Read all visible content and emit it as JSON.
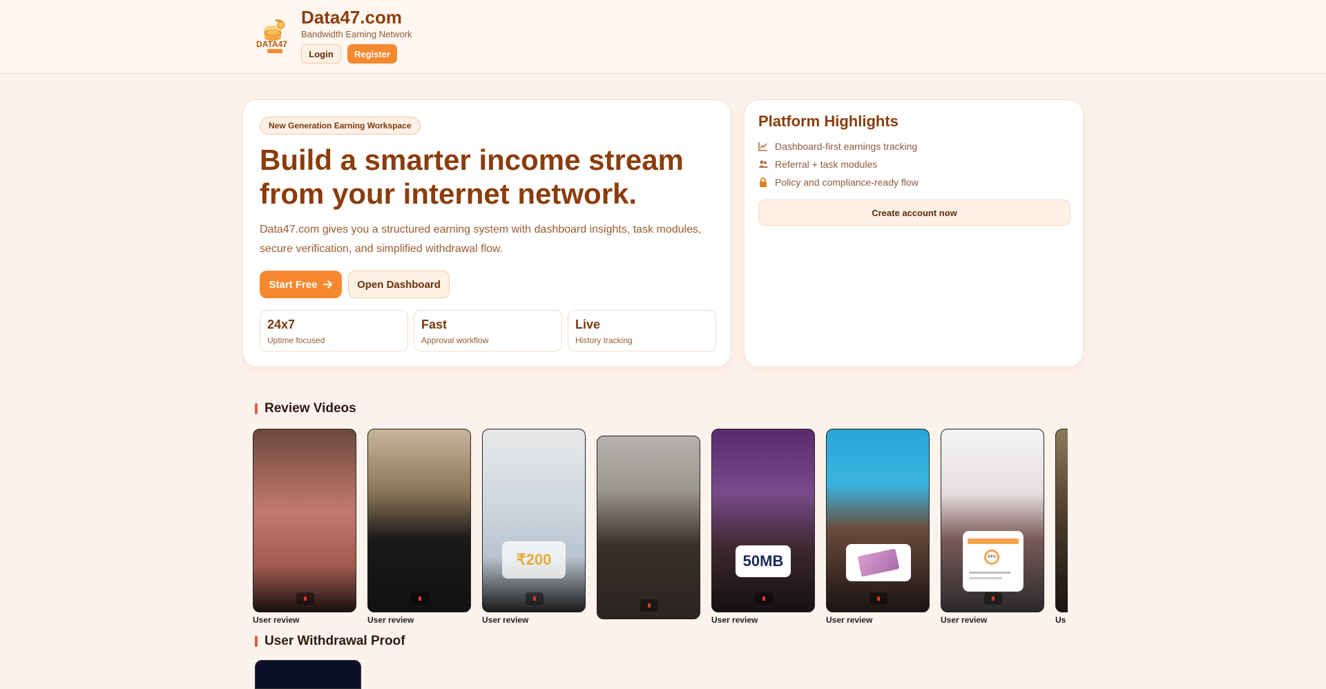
{
  "header": {
    "brand_title": "Data47.com",
    "brand_subtitle": "Bandwidth Earning Network",
    "login_label": "Login",
    "register_label": "Register",
    "logo_text": "DATA47"
  },
  "hero": {
    "badge": "New Generation Earning Workspace",
    "title": "Build a smarter income stream from your internet network.",
    "description": "Data47.com gives you a structured earning system with dashboard insights, task modules, secure verification, and simplified withdrawal flow.",
    "start_label": "Start Free",
    "dashboard_label": "Open Dashboard",
    "stats": [
      {
        "value": "24x7",
        "label": "Uptime focused"
      },
      {
        "value": "Fast",
        "label": "Approval workflow"
      },
      {
        "value": "Live",
        "label": "History tracking"
      }
    ]
  },
  "highlights": {
    "title": "Platform Highlights",
    "items": [
      {
        "icon": "chart-line-icon",
        "label": "Dashboard-first earnings tracking"
      },
      {
        "icon": "users-icon",
        "label": "Referral + task modules"
      },
      {
        "icon": "lock-icon",
        "label": "Policy and compliance-ready flow"
      }
    ],
    "create_label": "Create account now"
  },
  "reviews": {
    "title": "Review Videos",
    "items": [
      {
        "label": "User review",
        "overlay": ""
      },
      {
        "label": "User review",
        "overlay": ""
      },
      {
        "label": "User review",
        "overlay": "₹200"
      },
      {
        "label": "",
        "overlay": ""
      },
      {
        "label": "User review",
        "overlay": "50MB"
      },
      {
        "label": "User review",
        "overlay": ""
      },
      {
        "label": "User review",
        "overlay": "94%"
      },
      {
        "label": "Us",
        "overlay": ""
      }
    ]
  },
  "withdrawal": {
    "title": "User Withdrawal Proof"
  },
  "colors": {
    "accent": "#f6892f",
    "brand_text": "#8a3d0c",
    "background": "#fdf3ec"
  }
}
